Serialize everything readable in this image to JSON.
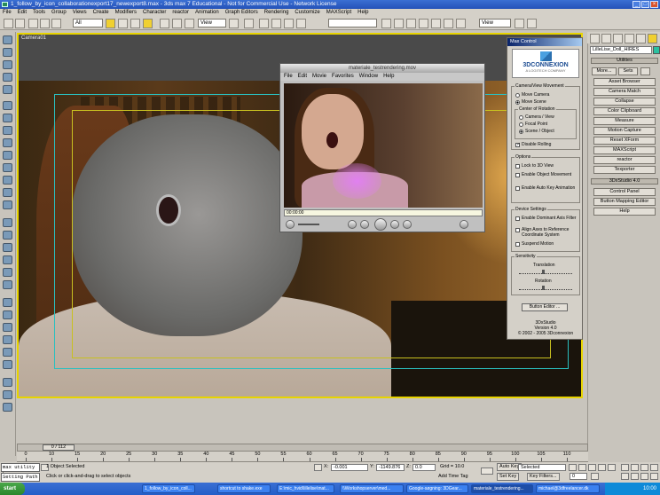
{
  "window": {
    "title": "1_follow_by_icon_collaborationexport17_newexport8.max - 3ds max 7 Educational - Not for Commercial Use - Network License",
    "buttons": [
      "_",
      "□",
      "×"
    ]
  },
  "menu": [
    "File",
    "Edit",
    "Tools",
    "Group",
    "Views",
    "Create",
    "Modifiers",
    "Character",
    "reactor",
    "Animation",
    "Graph Editors",
    "Rendering",
    "Customize",
    "MAXScript",
    "Help"
  ],
  "toolbar": {
    "selection_filter": "All",
    "ref_coord": "View",
    "ref_coord2": "View"
  },
  "viewport": {
    "label": "Camera01"
  },
  "quicktime": {
    "title": "materiale_testrendering.mov",
    "menu": [
      "File",
      "Edit",
      "Movie",
      "Favorites",
      "Window",
      "Help"
    ],
    "timecode": "00:00:00"
  },
  "motion_control": {
    "title": "Max Control",
    "brand": "3DCONNEXION",
    "brand_sub": "A LOGITECH COMPANY",
    "camera_group": "Camera/View Movement",
    "move_camera": "Move Camera",
    "move_scene": "Move Scene",
    "center_group": "Center of Rotation",
    "camera_view": "Camera / View",
    "focal_point": "Focal Point",
    "scene_object": "Scene / Object",
    "disable_rolling": "Disable Rolling",
    "options_group": "Options",
    "lock_3d_view": "Lock to 3D View",
    "enable_object_movement": "Enable Object Movement",
    "enable_auto_key": "Enable Auto Key Animation",
    "device_group": "Device Settings",
    "enable_dominant": "Enable Dominant Axis Filter",
    "align_axes": "Align Axes to Reference Coordinate System",
    "suspend_motion": "Suspend Motion",
    "sensitivity_group": "Sensitivity",
    "translation": "Translation",
    "rotation": "Rotation",
    "button_editor": "Button Editor ...",
    "footer": [
      "3DxStudio",
      "Version 4.0",
      "© 2002 - 2005 3Dconnexion"
    ]
  },
  "command_panel": {
    "object_name": "LilleLise_Doll_HIRES",
    "utilities_rollout": "Utilities",
    "more": "More...",
    "sets": "Sets",
    "utilities": [
      "Asset Browser",
      "Camera Match",
      "Collapse",
      "Color Clipboard",
      "Measure",
      "Motion Capture",
      "Reset XForm",
      "MAXScript",
      "reactor",
      "Texporter"
    ],
    "studio_rollout": "3DxStudio 4.0",
    "control_panel": "Control Panel",
    "button_mapping": "Button Mapping Editor",
    "help": "Help"
  },
  "timeline": {
    "slider_label": "0 / 112",
    "ticks": [
      "0",
      "10",
      "15",
      "20",
      "25",
      "30",
      "35",
      "40",
      "45",
      "50",
      "55",
      "60",
      "65",
      "70",
      "75",
      "80",
      "85",
      "90",
      "95",
      "100",
      "105",
      "110"
    ]
  },
  "status": {
    "script_line1": "max utility b",
    "script_line2": "Setting Path",
    "selected": "1 Object Selected",
    "prompt": "Click or click-and-drag to select objects",
    "x_label": "X:",
    "x_value": "-0.001",
    "y_label": "Y:",
    "y_value": "-1149.876",
    "z_label": "Z:",
    "z_value": "0.0",
    "grid": "Grid = 10.0",
    "add_time_tag": "Add Time Tag",
    "auto_key": "Auto Key",
    "set_key": "Set Key",
    "key_mode": "Selected",
    "key_filters": "Key Filters...",
    "frame": "0"
  },
  "taskbar": {
    "start": "start",
    "tasks": [
      "1_follow_by_icon_coll...",
      "shortcut to shake.exe",
      "E:\\mic_hvid\\lillelise\\mat...",
      "\\\\Workshopserver\\med...",
      "Google-søgning: 3DGear...",
      "materiale_testrendering...",
      "michael@3dfreelancer.dk"
    ],
    "clock": "10:00"
  }
}
